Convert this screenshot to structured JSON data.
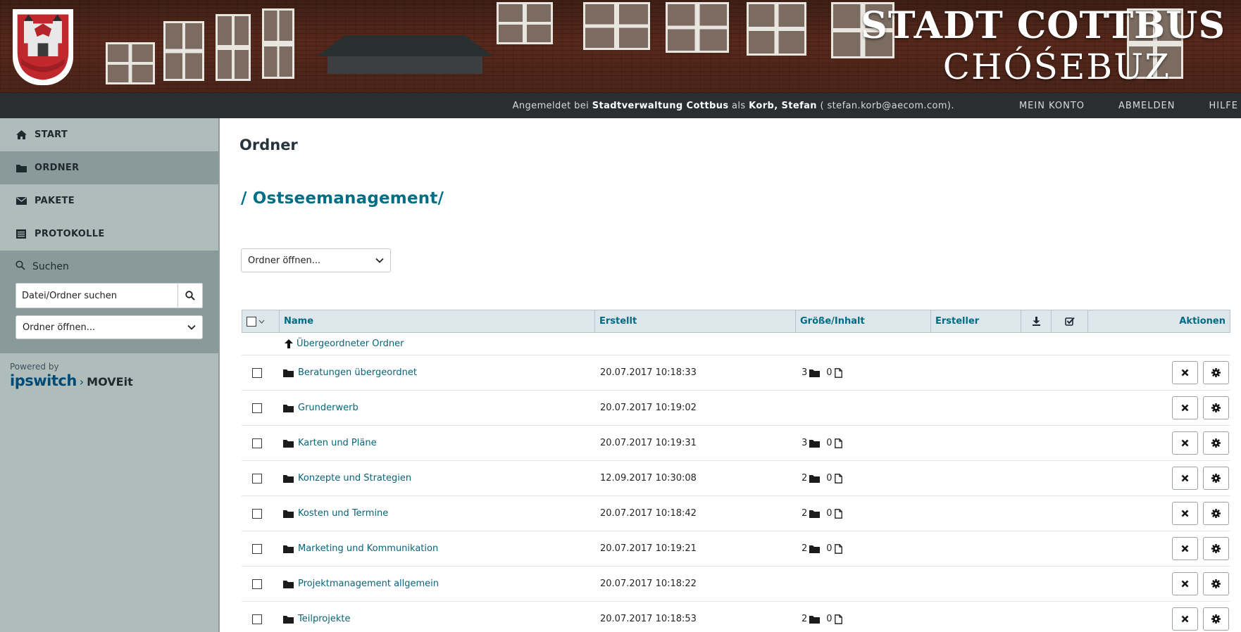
{
  "banner": {
    "title": "STADT COTTBUS",
    "subtitle": "CHÓŚEBUZ"
  },
  "topbar": {
    "login_prefix": "Angemeldet bei ",
    "organization": "Stadtverwaltung Cottbus",
    "login_middle": " als ",
    "user": "Korb, Stefan",
    "email": " ( stefan.korb@aecom.com).",
    "links": [
      "MEIN KONTO",
      "ABMELDEN",
      "HILFE"
    ]
  },
  "sidebar": {
    "items": [
      {
        "label": "START",
        "icon": "home-icon"
      },
      {
        "label": "ORDNER",
        "icon": "folder-icon"
      },
      {
        "label": "PAKETE",
        "icon": "envelope-icon"
      },
      {
        "label": "PROTOKOLLE",
        "icon": "log-icon"
      }
    ],
    "active_index": 1,
    "search": {
      "title": "Suchen",
      "placeholder": "Datei/Ordner suchen",
      "select_value": "Ordner öffnen..."
    },
    "powered_by": "Powered by",
    "brand_ips": "ipswitch",
    "brand_sep": "›",
    "brand_product": "MOVEit"
  },
  "main": {
    "title": "Ordner",
    "path": "/ Ostseemanagement/",
    "select_value": "Ordner öffnen...",
    "table": {
      "headers": {
        "name": "Name",
        "created": "Erstellt",
        "size": "Größe/Inhalt",
        "creator": "Ersteller",
        "actions": "Aktionen"
      },
      "parent_label": "Übergeordneter Ordner",
      "rows": [
        {
          "name": "Beratungen übergeordnet",
          "created": "20.07.2017 10:18:33",
          "folders": "3",
          "files": "0"
        },
        {
          "name": "Grunderwerb",
          "created": "20.07.2017 10:19:02",
          "folders": "",
          "files": ""
        },
        {
          "name": "Karten und Pläne",
          "created": "20.07.2017 10:19:31",
          "folders": "3",
          "files": "0"
        },
        {
          "name": "Konzepte und Strategien",
          "created": "12.09.2017 10:30:08",
          "folders": "2",
          "files": "0"
        },
        {
          "name": "Kosten und Termine",
          "created": "20.07.2017 10:18:42",
          "folders": "2",
          "files": "0"
        },
        {
          "name": "Marketing und Kommunikation",
          "created": "20.07.2017 10:19:21",
          "folders": "2",
          "files": "0"
        },
        {
          "name": "Projektmanagement allgemein",
          "created": "20.07.2017 10:18:22",
          "folders": "",
          "files": ""
        },
        {
          "name": "Teilprojekte",
          "created": "20.07.2017 10:18:53",
          "folders": "2",
          "files": "0"
        }
      ]
    }
  },
  "colors": {
    "link": "#0b6378",
    "path": "#006f86",
    "sidebar": "#aebcba",
    "sidebar_active": "#8a9a9a",
    "topbar": "#2b2e30",
    "table_header": "#dde6ea"
  }
}
